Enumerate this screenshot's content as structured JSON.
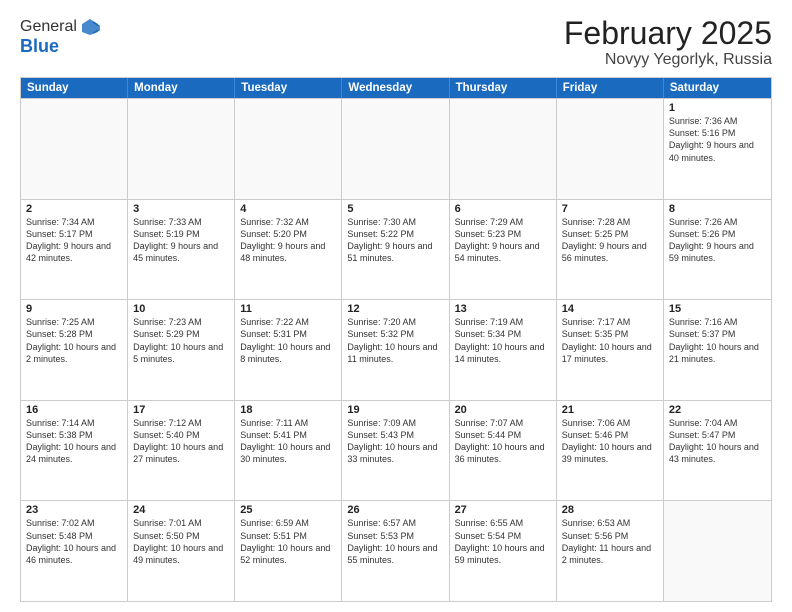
{
  "header": {
    "logo_general": "General",
    "logo_blue": "Blue",
    "month_title": "February 2025",
    "location": "Novyy Yegorlyk, Russia"
  },
  "days_of_week": [
    "Sunday",
    "Monday",
    "Tuesday",
    "Wednesday",
    "Thursday",
    "Friday",
    "Saturday"
  ],
  "weeks": [
    [
      {
        "day": "",
        "text": ""
      },
      {
        "day": "",
        "text": ""
      },
      {
        "day": "",
        "text": ""
      },
      {
        "day": "",
        "text": ""
      },
      {
        "day": "",
        "text": ""
      },
      {
        "day": "",
        "text": ""
      },
      {
        "day": "1",
        "text": "Sunrise: 7:36 AM\nSunset: 5:16 PM\nDaylight: 9 hours and 40 minutes."
      }
    ],
    [
      {
        "day": "2",
        "text": "Sunrise: 7:34 AM\nSunset: 5:17 PM\nDaylight: 9 hours and 42 minutes."
      },
      {
        "day": "3",
        "text": "Sunrise: 7:33 AM\nSunset: 5:19 PM\nDaylight: 9 hours and 45 minutes."
      },
      {
        "day": "4",
        "text": "Sunrise: 7:32 AM\nSunset: 5:20 PM\nDaylight: 9 hours and 48 minutes."
      },
      {
        "day": "5",
        "text": "Sunrise: 7:30 AM\nSunset: 5:22 PM\nDaylight: 9 hours and 51 minutes."
      },
      {
        "day": "6",
        "text": "Sunrise: 7:29 AM\nSunset: 5:23 PM\nDaylight: 9 hours and 54 minutes."
      },
      {
        "day": "7",
        "text": "Sunrise: 7:28 AM\nSunset: 5:25 PM\nDaylight: 9 hours and 56 minutes."
      },
      {
        "day": "8",
        "text": "Sunrise: 7:26 AM\nSunset: 5:26 PM\nDaylight: 9 hours and 59 minutes."
      }
    ],
    [
      {
        "day": "9",
        "text": "Sunrise: 7:25 AM\nSunset: 5:28 PM\nDaylight: 10 hours and 2 minutes."
      },
      {
        "day": "10",
        "text": "Sunrise: 7:23 AM\nSunset: 5:29 PM\nDaylight: 10 hours and 5 minutes."
      },
      {
        "day": "11",
        "text": "Sunrise: 7:22 AM\nSunset: 5:31 PM\nDaylight: 10 hours and 8 minutes."
      },
      {
        "day": "12",
        "text": "Sunrise: 7:20 AM\nSunset: 5:32 PM\nDaylight: 10 hours and 11 minutes."
      },
      {
        "day": "13",
        "text": "Sunrise: 7:19 AM\nSunset: 5:34 PM\nDaylight: 10 hours and 14 minutes."
      },
      {
        "day": "14",
        "text": "Sunrise: 7:17 AM\nSunset: 5:35 PM\nDaylight: 10 hours and 17 minutes."
      },
      {
        "day": "15",
        "text": "Sunrise: 7:16 AM\nSunset: 5:37 PM\nDaylight: 10 hours and 21 minutes."
      }
    ],
    [
      {
        "day": "16",
        "text": "Sunrise: 7:14 AM\nSunset: 5:38 PM\nDaylight: 10 hours and 24 minutes."
      },
      {
        "day": "17",
        "text": "Sunrise: 7:12 AM\nSunset: 5:40 PM\nDaylight: 10 hours and 27 minutes."
      },
      {
        "day": "18",
        "text": "Sunrise: 7:11 AM\nSunset: 5:41 PM\nDaylight: 10 hours and 30 minutes."
      },
      {
        "day": "19",
        "text": "Sunrise: 7:09 AM\nSunset: 5:43 PM\nDaylight: 10 hours and 33 minutes."
      },
      {
        "day": "20",
        "text": "Sunrise: 7:07 AM\nSunset: 5:44 PM\nDaylight: 10 hours and 36 minutes."
      },
      {
        "day": "21",
        "text": "Sunrise: 7:06 AM\nSunset: 5:46 PM\nDaylight: 10 hours and 39 minutes."
      },
      {
        "day": "22",
        "text": "Sunrise: 7:04 AM\nSunset: 5:47 PM\nDaylight: 10 hours and 43 minutes."
      }
    ],
    [
      {
        "day": "23",
        "text": "Sunrise: 7:02 AM\nSunset: 5:48 PM\nDaylight: 10 hours and 46 minutes."
      },
      {
        "day": "24",
        "text": "Sunrise: 7:01 AM\nSunset: 5:50 PM\nDaylight: 10 hours and 49 minutes."
      },
      {
        "day": "25",
        "text": "Sunrise: 6:59 AM\nSunset: 5:51 PM\nDaylight: 10 hours and 52 minutes."
      },
      {
        "day": "26",
        "text": "Sunrise: 6:57 AM\nSunset: 5:53 PM\nDaylight: 10 hours and 55 minutes."
      },
      {
        "day": "27",
        "text": "Sunrise: 6:55 AM\nSunset: 5:54 PM\nDaylight: 10 hours and 59 minutes."
      },
      {
        "day": "28",
        "text": "Sunrise: 6:53 AM\nSunset: 5:56 PM\nDaylight: 11 hours and 2 minutes."
      },
      {
        "day": "",
        "text": ""
      }
    ]
  ]
}
